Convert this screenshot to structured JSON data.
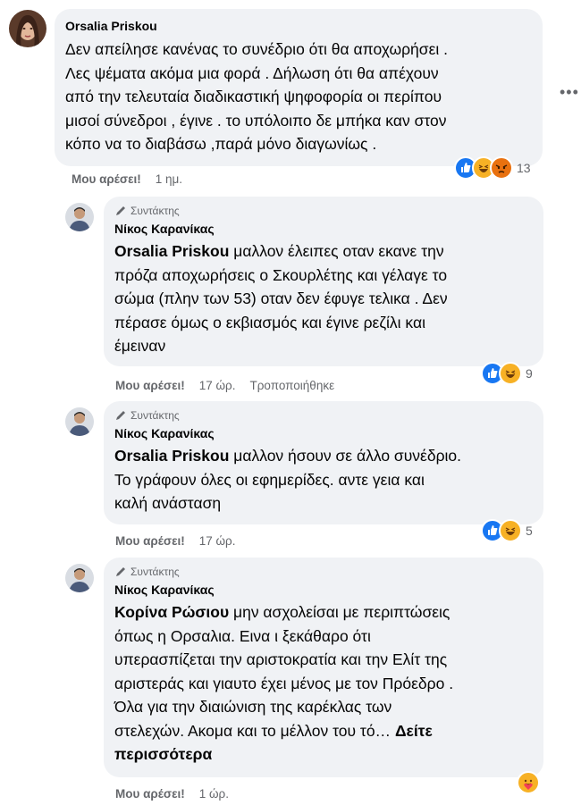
{
  "comments": [
    {
      "author": "Orsalia Priskou",
      "badge": "",
      "mention": "",
      "text_lines": [
        "Δεν απείλησε κανένας το συνέδριο ότι θα αποχωρήσει .",
        "Λες ψέματα ακόμα μια φορά . Δήλωση ότι θα απέχουν",
        "από την τελευταία διαδικαστική ψηφοφορία οι περίπου",
        "μισοί σύνεδροι , έγινε . το υπόλοιπο δε μπήκα καν στον",
        "κόπο να το διαβάσω ,παρά μόνο διαγωνίως ."
      ],
      "like_label": "Μου αρέσει!",
      "time": "1 ημ.",
      "edited": "",
      "reaction_count": "13",
      "reaction_icons": [
        "like-icon",
        "haha-icon",
        "angry-icon"
      ]
    },
    {
      "author": "Νίκος Καρανίκας",
      "badge": "Συντάκτης",
      "mention": "Orsalia Priskou",
      "text_lines": [
        " μαλλον έλειπες οταν εκανε την",
        "πρόζα αποχωρήσεις ο Σκουρλέτης και γέλαγε το",
        "σώμα (πλην των 53) οταν δεν έφυγε τελικα . Δεν",
        "πέρασε όμως ο εκβιασμός και έγινε ρεζίλι και",
        "έμειναν"
      ],
      "like_label": "Μου αρέσει!",
      "time": "17 ώρ.",
      "edited": "Τροποποιήθηκε",
      "reaction_count": "9",
      "reaction_icons": [
        "like-icon",
        "haha-icon"
      ]
    },
    {
      "author": "Νίκος Καρανίκας",
      "badge": "Συντάκτης",
      "mention": "Orsalia Priskou",
      "text_lines": [
        " μαλλον ήσουν σε άλλο συνέδριο.",
        "Το γράφουν όλες οι εφημερίδες. αντε γεια και",
        "καλή ανάσταση"
      ],
      "like_label": "Μου αρέσει!",
      "time": "17 ώρ.",
      "edited": "",
      "reaction_count": "5",
      "reaction_icons": [
        "like-icon",
        "haha-icon"
      ]
    },
    {
      "author": "Νίκος Καρανίκας",
      "badge": "Συντάκτης",
      "mention": "Κορίνα Ρώσιου",
      "text_lines": [
        " μην ασχολείσαι με περιπτώσεις",
        "όπως η Ορσαλια. Εινα ι ξεκάθαρο ότι",
        "υπερασπίζεται την αριστοκρατία και την Ελίτ της",
        "αριστεράς και γιαυτο έχει μένος με τον Πρόεδρο .",
        "Όλα για την διαιώνιση της καρέκλας των",
        "στελεχών. Ακομα και το μέλλον του τό… "
      ],
      "see_more": [
        "Δείτε",
        "περισσότερα"
      ],
      "like_label": "Μου αρέσει!",
      "time": "1 ώρ.",
      "edited": "",
      "reaction_count": "",
      "reaction_icons": [
        "care-icon"
      ]
    }
  ],
  "colors": {
    "bubble": "#f0f2f5",
    "secondary_text": "#65676b",
    "like_blue": "#1877f2",
    "haha_yellow": "#f7b125",
    "angry_orange": "#e9710f"
  }
}
